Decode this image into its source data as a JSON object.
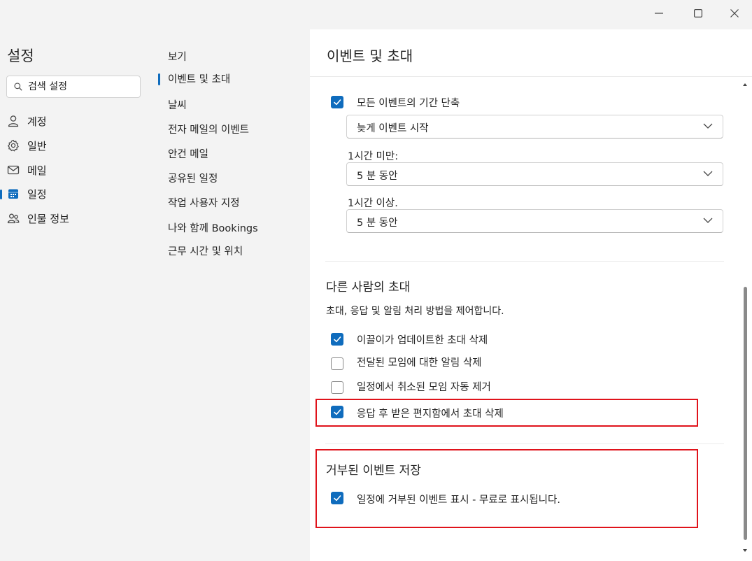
{
  "window": {
    "minimize_icon": "minimize-icon",
    "maximize_icon": "maximize-icon",
    "close_icon": "close-icon"
  },
  "left_nav": {
    "title": "설정",
    "search_placeholder": "검색 설정",
    "items": [
      {
        "label": "계정",
        "icon": "person-icon"
      },
      {
        "label": "일반",
        "icon": "gear-icon"
      },
      {
        "label": "메일",
        "icon": "mail-icon"
      },
      {
        "label": "일정",
        "icon": "calendar-icon",
        "active": true
      },
      {
        "label": "인물 정보",
        "icon": "people-icon"
      }
    ]
  },
  "mid_nav": {
    "items": [
      {
        "label": "보기"
      },
      {
        "label": "이벤트 및 초대",
        "active": true
      },
      {
        "label": "날씨"
      },
      {
        "label": "전자 메일의 이벤트"
      },
      {
        "label": "안건 메일"
      },
      {
        "label": "공유된 일정"
      },
      {
        "label": "작업 사용자 지정"
      },
      {
        "label": "나와 함께 Bookings"
      },
      {
        "label": "근무 시간 및 위치"
      }
    ]
  },
  "content": {
    "header": "이벤트 및 초대",
    "shorten_events": {
      "label": "모든 이벤트의 기간 단축",
      "checked": true
    },
    "start_mode": "늦게 이벤트 시작",
    "under_hour_label": "1시간 미만:",
    "under_hour_value": "5 분 동안",
    "over_hour_label": "1시간 이상.",
    "over_hour_value": "5 분 동안",
    "others_invites": {
      "title": "다른 사람의 초대",
      "description": "초대, 응답 및 알림 처리 방법을 제어합니다.",
      "options": [
        {
          "label": "이끌이가 업데이트한 초대 삭제",
          "checked": true
        },
        {
          "label": "전달된 모임에 대한 알림 삭제",
          "checked": false
        },
        {
          "label": "일정에서 취소된 모임 자동 제거",
          "checked": false
        },
        {
          "label": "응답 후 받은 편지함에서 초대 삭제",
          "checked": true
        }
      ]
    },
    "declined_events": {
      "title": "거부된 이벤트 저장",
      "option": {
        "label": "일정에 거부된 이벤트 표시 - 무료로 표시됩니다.",
        "checked": true
      }
    }
  },
  "colors": {
    "accent": "#0f6cbd",
    "highlight": "#e0131b"
  }
}
